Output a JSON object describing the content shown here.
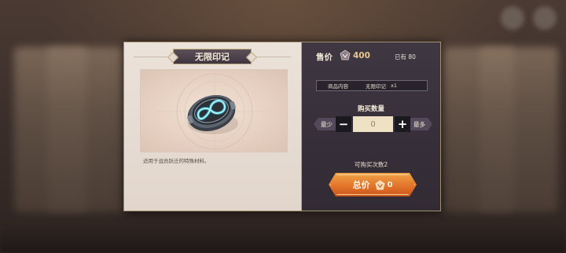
{
  "dialog": {
    "title": "无限印记",
    "description": "适用于战员跃迁的特殊材料。",
    "price_label": "售价",
    "price_value": "400",
    "owned_text": "已有 80",
    "content": {
      "label": "商品内容",
      "item_name": "无限印记",
      "item_qty": "x1"
    },
    "quantity": {
      "title": "购买数量",
      "min_label": "最少",
      "max_label": "最多",
      "minus_symbol": "−",
      "plus_symbol": "+",
      "value": "0"
    },
    "purchase_times": "可购买次数2",
    "total": {
      "label": "总价",
      "value": "0"
    }
  },
  "icons": {
    "price": "currency-crest-icon",
    "total": "currency-crest-icon",
    "item": "infinite-mark-token-icon"
  },
  "colors": {
    "accent_orange": "#e3742a",
    "price_gold": "#e8c98f",
    "panel_dark": "#3f3742",
    "panel_light": "#ebe2da"
  }
}
